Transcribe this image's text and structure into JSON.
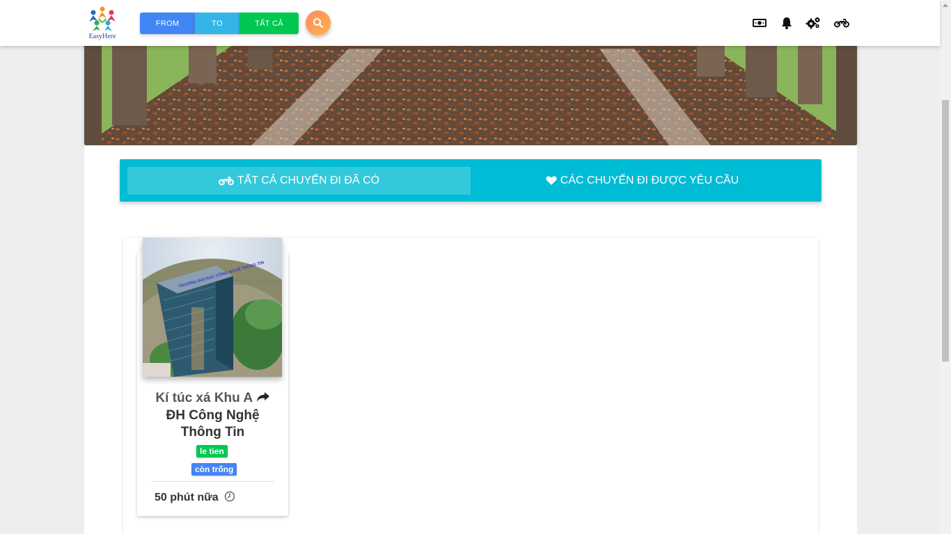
{
  "brand": {
    "name": "EasyHere",
    "color": "#2a4aa0"
  },
  "filters": {
    "from_label": "FROM",
    "to_label": "TO",
    "all_label": "TẤT CẢ",
    "colors": {
      "from": "#4285f4",
      "to": "#33b5e5",
      "all": "#00c851"
    }
  },
  "search": {
    "icon": "search-icon"
  },
  "nav_icons": [
    "money-icon",
    "bell-icon",
    "cogs-icon",
    "motorcycle-icon"
  ],
  "tabs": [
    {
      "label": "TẤT CẢ CHUYẾN ĐI ĐÃ CÓ",
      "icon": "motorcycle-icon",
      "active": true
    },
    {
      "label": "CÁC CHUYẾN ĐI ĐƯỢC YÊU CẦU",
      "icon": "heart-icon",
      "active": false
    }
  ],
  "accent_color": "#00bcd4",
  "trips": [
    {
      "from": "Kí túc xá Khu A",
      "to": "ĐH Công Nghệ Thông Tin",
      "driver": "le tien",
      "status": "còn trống",
      "time": "50 phút nữa",
      "photo_caption": "TRƯỜNG ĐẠI HỌC CÔNG NGHỆ THÔNG TIN"
    }
  ]
}
